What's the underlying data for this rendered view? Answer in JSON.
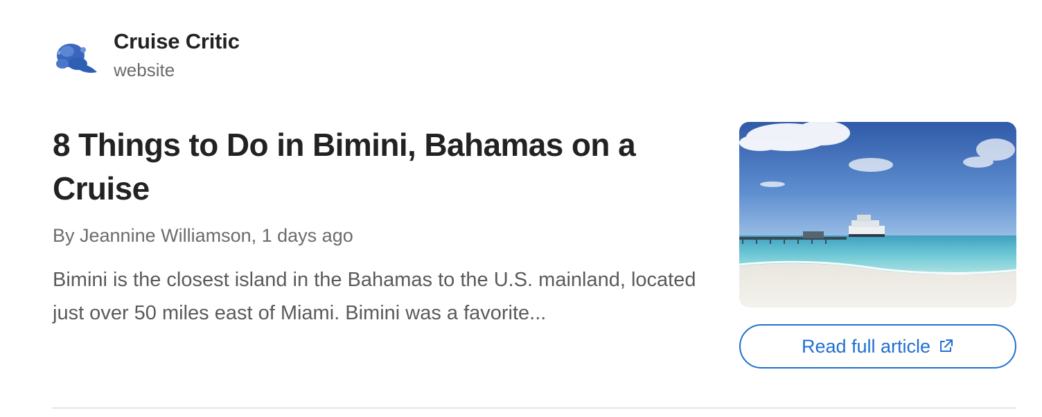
{
  "source": {
    "name": "Cruise Critic",
    "type": "website",
    "logo_icon": "blue-wave-splash-icon",
    "logo_color": "#2f5fb5"
  },
  "article": {
    "title": "8 Things to Do in Bimini, Bahamas on a Cruise",
    "byline": "By Jeannine Williamson, 1 days ago",
    "summary": "Bimini is the closest island in the Bahamas to the U.S. mainland, located just over 50 miles east of Miami. Bimini was a favorite...",
    "thumbnail_icon": "beach-cruise-ship-photo"
  },
  "actions": {
    "read_full_label": "Read full article",
    "read_full_icon": "external-link-icon"
  },
  "colors": {
    "accent": "#1f6fd1",
    "text_primary": "#222222",
    "text_secondary": "#6b6b6b",
    "divider": "#e3e3e3"
  }
}
